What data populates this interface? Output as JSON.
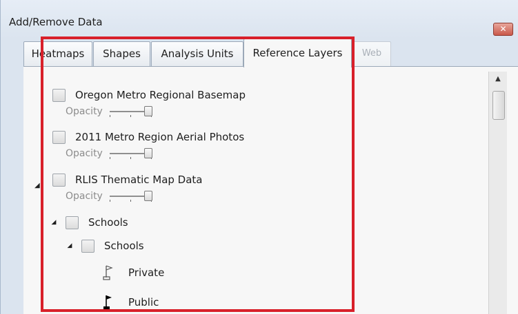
{
  "window": {
    "title": "Add/Remove Data",
    "close_glyph": "✕"
  },
  "tabs": [
    {
      "label": "Heatmaps",
      "state": "normal"
    },
    {
      "label": "Shapes",
      "state": "normal"
    },
    {
      "label": "Analysis Units",
      "state": "normal"
    },
    {
      "label": "Reference Layers",
      "state": "active"
    },
    {
      "label": "Web",
      "state": "disabled"
    }
  ],
  "layers": [
    {
      "label": "Oregon Metro Regional Basemap",
      "checked": false,
      "opacity_label": "Opacity",
      "opacity": 1.0
    },
    {
      "label": "2011 Metro Region Aerial Photos",
      "checked": false,
      "opacity_label": "Opacity",
      "opacity": 1.0
    },
    {
      "label": "RLIS Thematic Map Data",
      "checked": false,
      "opacity_label": "Opacity",
      "opacity": 1.0
    }
  ],
  "tree": {
    "group": {
      "label": "Schools",
      "expanded": true,
      "checked": false
    },
    "subgroup": {
      "label": "Schools",
      "expanded": true,
      "checked": false
    },
    "legend": [
      {
        "label": "Private",
        "icon": "hollow-flag-icon"
      },
      {
        "label": "Public",
        "icon": "filled-flag-icon"
      }
    ]
  },
  "colors": {
    "highlight": "#d8202a",
    "window_bg": "#dbe4ef",
    "panel_bg": "#f7f7f7"
  }
}
